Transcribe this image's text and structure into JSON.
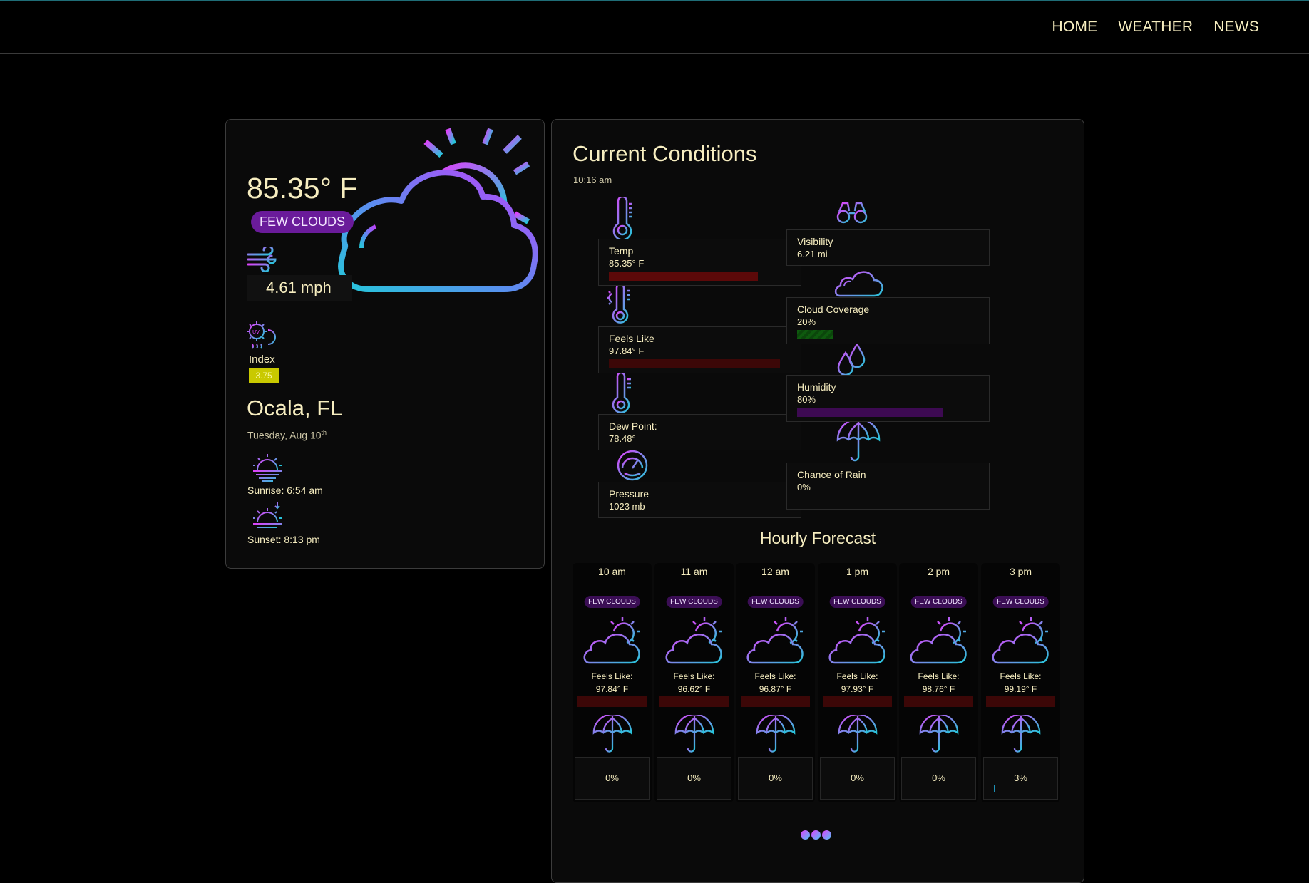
{
  "nav": {
    "links": [
      "HOME",
      "WEATHER",
      "NEWS"
    ]
  },
  "current": {
    "temperature": "85.35° F",
    "condition": "FEW CLOUDS",
    "wind": "4.61 mph",
    "uv_label": "Index",
    "uv_value": "3.75",
    "location": "Ocala, FL",
    "date": "Tuesday, Aug 10",
    "date_suffix": "th",
    "sunrise": "Sunrise: 6:54 am",
    "sunset": "Sunset: 8:13 pm"
  },
  "conditions": {
    "title": "Current Conditions",
    "time": "10:16 am",
    "left": [
      {
        "label": "Temp",
        "value": "85.35° F",
        "bar_fraction": 0.82,
        "bar_color": "#5c0909"
      },
      {
        "label": "Feels Like",
        "value": "97.84° F",
        "bar_fraction": 0.94,
        "bar_color": "#3c0707"
      },
      {
        "label": "Dew Point:",
        "value": "78.48°"
      },
      {
        "label": "Pressure",
        "value": "1023 mb"
      }
    ],
    "right": [
      {
        "label": "Visibility",
        "value": "6.21 mi"
      },
      {
        "label": "Cloud Coverage",
        "value": "20%",
        "bar_fraction": 0.2,
        "bar_color": "#0e5a0e"
      },
      {
        "label": "Humidity",
        "value": "80%",
        "bar_fraction": 0.8,
        "bar_color": "#3d0a52"
      },
      {
        "label": "Chance of Rain",
        "value": "0%"
      }
    ]
  },
  "hourly": {
    "title": "Hourly Forecast",
    "feels_label": "Feels Like:",
    "hours": [
      {
        "time": "10 am",
        "condition": "FEW CLOUDS",
        "feels": "97.84° F",
        "rain": "0%",
        "rain_fraction": 0
      },
      {
        "time": "11 am",
        "condition": "FEW CLOUDS",
        "feels": "96.62° F",
        "rain": "0%",
        "rain_fraction": 0
      },
      {
        "time": "12 am",
        "condition": "FEW CLOUDS",
        "feels": "96.87° F",
        "rain": "0%",
        "rain_fraction": 0
      },
      {
        "time": "1 pm",
        "condition": "FEW CLOUDS",
        "feels": "97.93° F",
        "rain": "0%",
        "rain_fraction": 0
      },
      {
        "time": "2 pm",
        "condition": "FEW CLOUDS",
        "feels": "98.76° F",
        "rain": "0%",
        "rain_fraction": 0
      },
      {
        "time": "3 pm",
        "condition": "FEW CLOUDS",
        "feels": "99.19° F",
        "rain": "3%",
        "rain_fraction": 0.03
      }
    ]
  },
  "colors": {
    "accent_pink": "#e040fb",
    "accent_cyan": "#26c6da",
    "text": "#f7eec0"
  }
}
